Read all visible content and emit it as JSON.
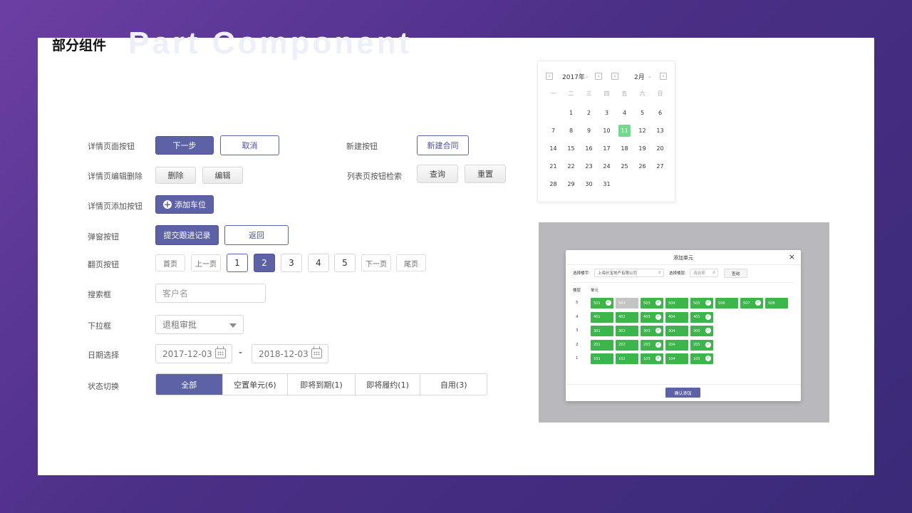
{
  "title": "部分组件",
  "subtitle": "Part Component",
  "rows": {
    "detail_buttons": {
      "label": "详情页面按钮",
      "next": "下一步",
      "cancel": "取消"
    },
    "new_button": {
      "label": "新建按钮",
      "new_contract": "新建合同"
    },
    "detail_edit_delete": {
      "label": "详情页编辑删除",
      "delete": "删除",
      "edit": "编辑"
    },
    "list_search_buttons": {
      "label": "列表页按钮检索",
      "query": "查询",
      "reset": "重置"
    },
    "detail_add": {
      "label": "详情页添加按钮",
      "add_parking": "添加车位",
      "icon": "plus-circle-icon"
    },
    "popup_buttons": {
      "label": "弹窗按钮",
      "submit": "提交跟进记录",
      "back": "返回"
    },
    "pagination": {
      "label": "翻页按钮",
      "first": "首页",
      "prev": "上一页",
      "pages": [
        "1",
        "2",
        "3",
        "4",
        "5"
      ],
      "current": "2",
      "next": "下一页",
      "last": "尾页"
    },
    "search_box": {
      "label": "搜索框",
      "placeholder": "客户名"
    },
    "dropdown": {
      "label": "下拉框",
      "value": "退租审批"
    },
    "date_picker": {
      "label": "日期选择",
      "start": "2017-12-03",
      "separator": "-",
      "end": "2018-12-03"
    },
    "status_switch": {
      "label": "状态切换",
      "tabs": [
        "全部",
        "空置单元(6)",
        "即将到期(1)",
        "即将履约(1)",
        "自用(3)"
      ],
      "active": "全部"
    }
  },
  "calendar": {
    "year": "2017年",
    "month": "2月",
    "weekdays": [
      "一",
      "二",
      "三",
      "四",
      "五",
      "六",
      "日"
    ],
    "first_weekday_offset": 1,
    "days_in_month": 31,
    "selected_day": "11",
    "selected_color": "#6fdc8c"
  },
  "modal": {
    "title": "添加单元",
    "close": "×",
    "building_label": "选择楼宇:",
    "building_value": "上海长宝地产有限公司",
    "floor_label": "选择楼层:",
    "floor_placeholder": "请选择",
    "query": "查询",
    "col_floor": "楼层",
    "col_unit": "单元",
    "floors": [
      {
        "floor": "5",
        "units": [
          {
            "name": "501",
            "checked": true,
            "disabled": false
          },
          {
            "name": "502",
            "checked": false,
            "disabled": true
          },
          {
            "name": "503",
            "checked": true,
            "disabled": false
          },
          {
            "name": "504",
            "checked": false,
            "disabled": false
          },
          {
            "name": "505",
            "checked": true,
            "disabled": false
          },
          {
            "name": "506",
            "checked": false,
            "disabled": false
          },
          {
            "name": "507",
            "checked": true,
            "disabled": false
          },
          {
            "name": "508",
            "checked": false,
            "disabled": false
          }
        ]
      },
      {
        "floor": "4",
        "units": [
          {
            "name": "401",
            "checked": false,
            "disabled": false
          },
          {
            "name": "402",
            "checked": false,
            "disabled": false
          },
          {
            "name": "403",
            "checked": true,
            "disabled": false
          },
          {
            "name": "404",
            "checked": false,
            "disabled": false
          },
          {
            "name": "405",
            "checked": true,
            "disabled": false
          }
        ]
      },
      {
        "floor": "3",
        "units": [
          {
            "name": "301",
            "checked": false,
            "disabled": false
          },
          {
            "name": "302",
            "checked": false,
            "disabled": false
          },
          {
            "name": "303",
            "checked": true,
            "disabled": false
          },
          {
            "name": "304",
            "checked": false,
            "disabled": false
          },
          {
            "name": "305",
            "checked": true,
            "disabled": false
          }
        ]
      },
      {
        "floor": "2",
        "units": [
          {
            "name": "201",
            "checked": false,
            "disabled": false
          },
          {
            "name": "202",
            "checked": false,
            "disabled": false
          },
          {
            "name": "203",
            "checked": true,
            "disabled": false
          },
          {
            "name": "204",
            "checked": false,
            "disabled": false
          },
          {
            "name": "205",
            "checked": true,
            "disabled": false
          }
        ]
      },
      {
        "floor": "1",
        "units": [
          {
            "name": "101",
            "checked": false,
            "disabled": false
          },
          {
            "name": "102",
            "checked": false,
            "disabled": false
          },
          {
            "name": "103",
            "checked": true,
            "disabled": false
          },
          {
            "name": "104",
            "checked": false,
            "disabled": false
          },
          {
            "name": "105",
            "checked": true,
            "disabled": false
          }
        ]
      }
    ],
    "confirm": "确认添加"
  },
  "colors": {
    "primary": "#5d62a7",
    "unit_green": "#3cb54a",
    "unit_disabled": "#c4c4c4",
    "overlay": "#b9b9bd"
  }
}
